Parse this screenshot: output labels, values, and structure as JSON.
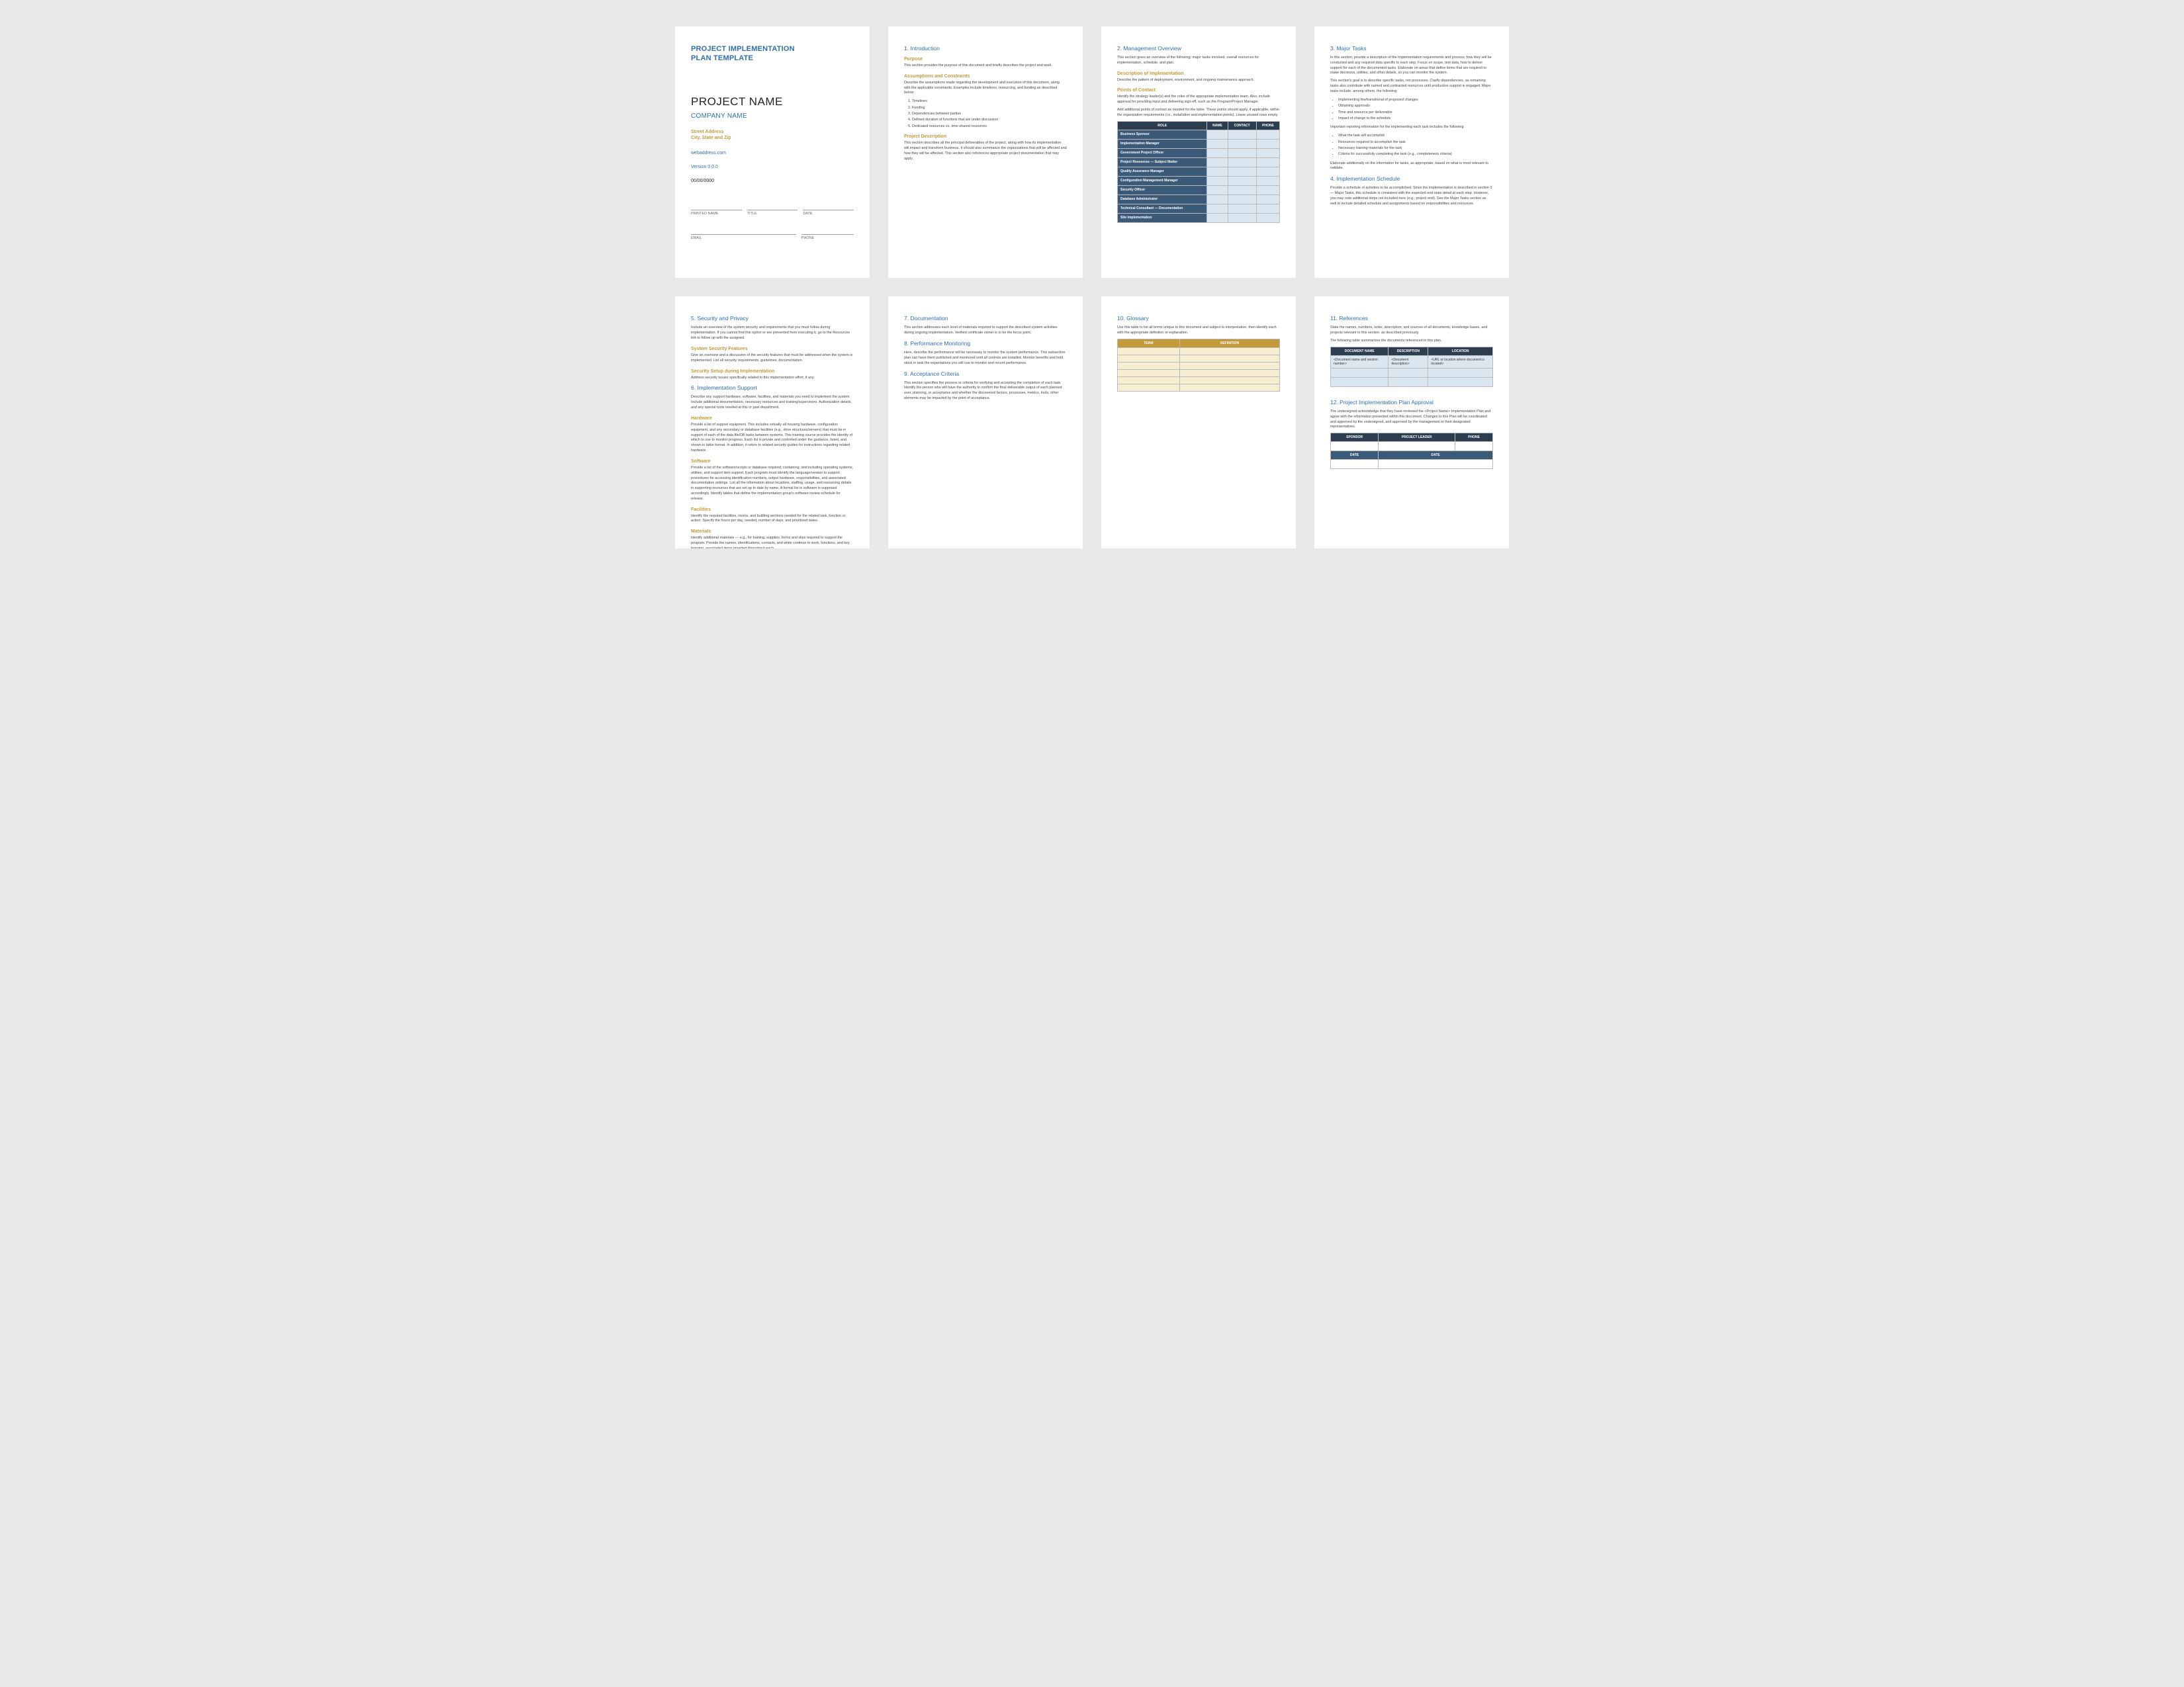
{
  "cover": {
    "template_title_line1": "PROJECT IMPLEMENTATION",
    "template_title_line2": "PLAN TEMPLATE",
    "project_name": "PROJECT NAME",
    "company_name": "COMPANY NAME",
    "address_line1": "Street Address",
    "address_line2": "City, State and Zip",
    "web": "webaddress.com",
    "version": "Version 0.0.0",
    "date": "00/00/0000",
    "sig1_a": "PRINTED NAME",
    "sig1_b": "TITLE",
    "sig1_c": "DATE",
    "sig2_a": "EMAIL",
    "sig2_b": "PHONE"
  },
  "p2": {
    "s1_title": "1. Introduction",
    "purpose_h": "Purpose",
    "purpose_b": "This section provides the purpose of this document and briefly describes the project and work.",
    "assump_h": "Assumptions and Constraints",
    "assump_b1": "Describe the assumptions made regarding the development and execution of this document, along with the applicable constraints. Examples include timelines, resourcing, and funding as described below:",
    "assump_list": [
      "Timelines",
      "Funding",
      "Dependencies between parties",
      "Defined duration of functions that are under discussion",
      "Dedicated resources vs. time-shared resources"
    ],
    "pdesc_h": "Project Description",
    "pdesc_b": "This section describes all the principal deliverables of the project, along with how its implementation will impact and transform business. It should also summarize the organizations that will be affected and how they will be affected. This section also references appropriate project documentation that may apply."
  },
  "p3": {
    "s2_title": "2. Management Overview",
    "s2_b": "This section gives an overview of the following: major tasks involved, overall resources for implementation, schedule, and plan.",
    "desc_h": "Description of Implementation",
    "desc_b": "Describe the pattern of deployment, environment, and ongoing maintenance approach.",
    "poc_h": "Points of Contact",
    "poc_b": "Identify the strategy leader(s) and the roles of the appropriate implementation team. Also, include approval for providing input and delivering sign-off, such as the Program/Project Manager.",
    "table_intro": "Add additional points of contact as needed for the table. These points should apply, if applicable, within the organization requirements (i.e., installation and implementation points). Leave unused rows empty.",
    "table_headers": [
      "ROLE",
      "NAME",
      "CONTACT",
      "PHONE"
    ],
    "table_rows": [
      "Business Sponsor",
      "Implementation Manager",
      "Government Project Officer",
      "Project Resources — Subject Matter",
      "Quality Assurance Manager",
      "Configuration Management Manager",
      "Security Officer",
      "Database Administrator",
      "Technical Consultant — Documentation",
      "Site Implementation"
    ]
  },
  "p4": {
    "s3_title": "3. Major Tasks",
    "b1": "In this section, provide a description of the implementation requirements and process: how they will be conducted and any required data specific to each step. Focus on scope, test data, how to deliver support for each of the documented tasks. Elaborate on areas that define items that are required to make decisions, utilities, and other details, so you can monitor the system.",
    "b2": "This section's goal is to describe specific tasks, not processes. Clarify dependencies, as remaining tasks also contribute with named and contracted resources until production support is engaged. Major tasks include, among others, the following:",
    "list1": [
      "Implementing the/transitional of proposed changes",
      "Obtaining approvals",
      "Time and resource per deliverable",
      "Impact of change to the schedule"
    ],
    "mid": "Important reporting information for the implementing each task includes the following:",
    "list2": [
      "What the task will accomplish",
      "Resources required to accomplish the task",
      "Necessary training materials for the task",
      "Criteria for successfully completing the task (e.g., completeness criteria)"
    ],
    "b3": "Elaborate additionally on the information for tasks, as appropriate, based on what is most relevant to validate.",
    "s4_title": "4. Implementation Schedule",
    "s4_b": "Provide a schedule of activities to be accomplished. Since the implementation is described in section 3 — Major Tasks, this schedule is consistent with the expected end-state detail at each step. However, you may note additional steps not included here (e.g., project end). See the Major Tasks section as well to include detailed schedule and assignments based on responsibilities and resources."
  },
  "p5": {
    "s5_title": "5. Security and Privacy",
    "s5_b1": "Include an overview of the system security and requirements that you must follow during implementation. If you cannot find this option or are prevented from executing it, go to the Resources link to follow up with the assigned.",
    "h_a": "System Security Features",
    "h_a_b": "Give an overview and a discussion of the security features that must be addressed when the system is implemented. List all security requirements, guidelines, documentation.",
    "h_b": "Security Setup during Implementation",
    "h_b_b": "Address security issues specifically related to this implementation effort, if any.",
    "s6_title": "6. Implementation Support",
    "s6_b": "Describe any support hardware, software, facilities, and materials you need to implement the system. Include additional documentation, necessary resources and training/supervisors. Authorization details, and any special tools needed at this or past department.",
    "h_hw": "Hardware",
    "h_hw_b": "Provide a list of support equipment. This includes virtually all housing hardware, configuration equipment, and any secondary or database facilities (e.g., drive structures/servers) that must be in support of each of the data file/DB tasks between systems. This training course provides the identity of which to use to monitor progress. Each list is private and controlled under the guidance, listed, and shown in table format. In addition, it refers to related security guides for instructions regarding related hardware.",
    "h_sw": "Software",
    "h_sw_b": "Provide a list of the software/scripts or database required, containing, and including operating systems, utilities, and support item support. Each program must identify the language/version to support procedures for accessing identification numbers, output hardware, responsibilities, and associated documentation settings. List all the information about locations, staffing, usage, and resourcing details in supporting resources that are set up to date by name. A formal list in software is supposed accordingly. Identify tables that define the implementation group's software review schedule for release.",
    "h_fac": "Facilities",
    "h_fac_b": "Identify the required facilities, rooms, and building sections needed for the related task, function or action. Specify the hours per day, needed, number of days, and prioritized dates.",
    "h_mat": "Materials",
    "h_mat_b": "Identify additional materials — e.g., for training, supplies, forms and slips required to support the program. Provide the names, identifications, contacts, and while continue to work, functions, and key learning, associated items provided throughout each."
  },
  "p6": {
    "s7_title": "7. Documentation",
    "s7_b": "This section addresses each level of materials required to support the described system activities during ongoing implementation. Verified certificate owner is to be the focus point.",
    "s8_title": "8. Performance Monitoring",
    "s8_b": "Here, describe the performance will be necessary to monitor the system performance. This subsection plan can have them published and monitored until all controls are installed. Monitor benefits and hold stock in task the expectations you will use to monitor and record performance.",
    "s9_title": "9. Acceptance Criteria",
    "s9_b": "This section specifies the process or criteria for verifying and accepting the completion of each task. Identify the person who will have the authority to confirm the final deliverable output of each planned user, planning, or acceptance and whether the discovered factors, processes, metrics, tools, other elements may be impacted by the point of acceptance."
  },
  "p7": {
    "s10_title": "10. Glossary",
    "s10_b": "Use this table to list all terms unique to this document and subject to interpretation, then identify each with the appropriate definition or explanation.",
    "table_headers": [
      "TERM",
      "DEFINITION"
    ]
  },
  "p8": {
    "s11_title": "11. References",
    "s11_b1": "State the names, numbers, order, description, and sources of all documents, knowledge bases, and projects relevant to this section, as described previously.",
    "s11_b2": "The following table summarizes the documents referenced in this plan.",
    "table_headers": [
      "DOCUMENT NAME",
      "DESCRIPTION",
      "LOCATION"
    ],
    "table_row1": [
      "<Document name and version number>",
      "<Document description>",
      "<URL or location where document is located>"
    ],
    "s12_title": "12. Project Implementation Plan Approval",
    "s12_b": "The undersigned acknowledge that they have reviewed the <Project Name> Implementation Plan and agree with the information presented within this document. Changes to this Plan will be coordinated and approved by the undersigned, and approved by the management or their designated representatives.",
    "app_headers": [
      "SPONSOR",
      "PROJECT LEADER",
      "PHONE"
    ],
    "app_row": [
      "DATE",
      "DATE"
    ]
  }
}
